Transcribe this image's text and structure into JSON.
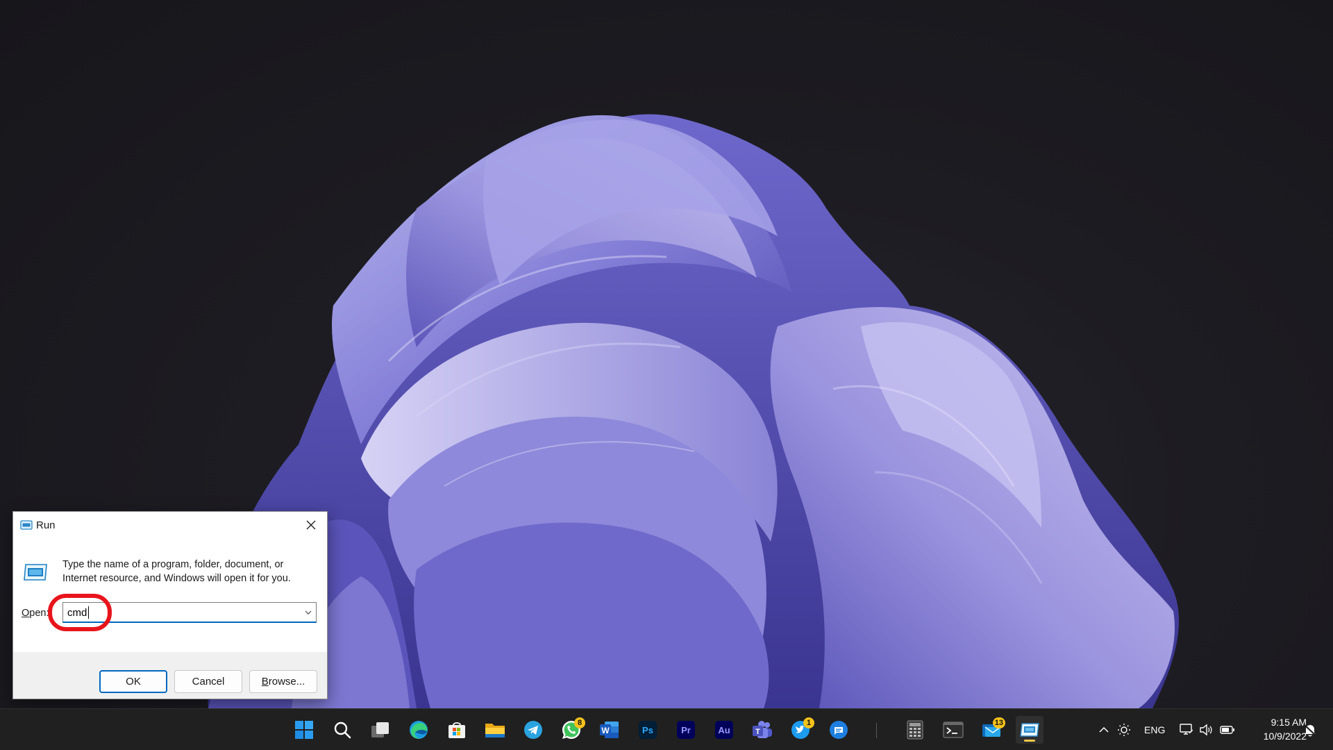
{
  "desktop": {
    "wallpaper": "Windows 11 bloom wallpaper (purple)",
    "colors": {
      "background": "#1b1a20",
      "bloom_light": "#a9a7e6",
      "bloom_mid": "#7670cf",
      "bloom_dark": "#3f3aa0"
    }
  },
  "run_dialog": {
    "title": "Run",
    "description": "Type the name of a program, folder, document, or Internet resource, and Windows will open it for you.",
    "open_label_underlined": "O",
    "open_label_rest": "pen:",
    "open_value": "cmd",
    "buttons": {
      "ok": "OK",
      "cancel": "Cancel",
      "browse_underlined": "B",
      "browse_rest": "rowse..."
    },
    "highlight_color": "#e8141c",
    "accent_color": "#0067c0"
  },
  "taskbar": {
    "pinned": [
      {
        "name": "start-button",
        "icon": "windows-logo-icon"
      },
      {
        "name": "search-button",
        "icon": "search-icon"
      },
      {
        "name": "task-view-button",
        "icon": "task-view-icon"
      },
      {
        "name": "edge-button",
        "icon": "edge-icon"
      },
      {
        "name": "store-button",
        "icon": "store-icon"
      },
      {
        "name": "file-explorer-button",
        "icon": "folder-icon"
      },
      {
        "name": "telegram-button",
        "icon": "telegram-icon"
      },
      {
        "name": "whatsapp-button",
        "icon": "whatsapp-icon",
        "badge": "8"
      },
      {
        "name": "word-button",
        "icon": "word-icon",
        "label": "W"
      },
      {
        "name": "photoshop-button",
        "icon": "photoshop-icon",
        "label": "Ps"
      },
      {
        "name": "premiere-button",
        "icon": "premiere-icon",
        "label": "Pr"
      },
      {
        "name": "audition-button",
        "icon": "audition-icon",
        "label": "Au"
      },
      {
        "name": "teams-button",
        "icon": "teams-icon"
      },
      {
        "name": "twitter-button",
        "icon": "twitter-icon",
        "badge": "1"
      },
      {
        "name": "messages-button",
        "icon": "chat-icon"
      },
      {
        "name": "calculator-button",
        "icon": "calculator-icon"
      },
      {
        "name": "terminal-button",
        "icon": "terminal-icon"
      },
      {
        "name": "mail-button",
        "icon": "mail-icon",
        "badge": "13"
      },
      {
        "name": "run-button",
        "icon": "run-icon",
        "active": true
      }
    ],
    "tray": {
      "language": "ENG",
      "time": "9:15 AM",
      "date": "10/9/2022"
    }
  }
}
